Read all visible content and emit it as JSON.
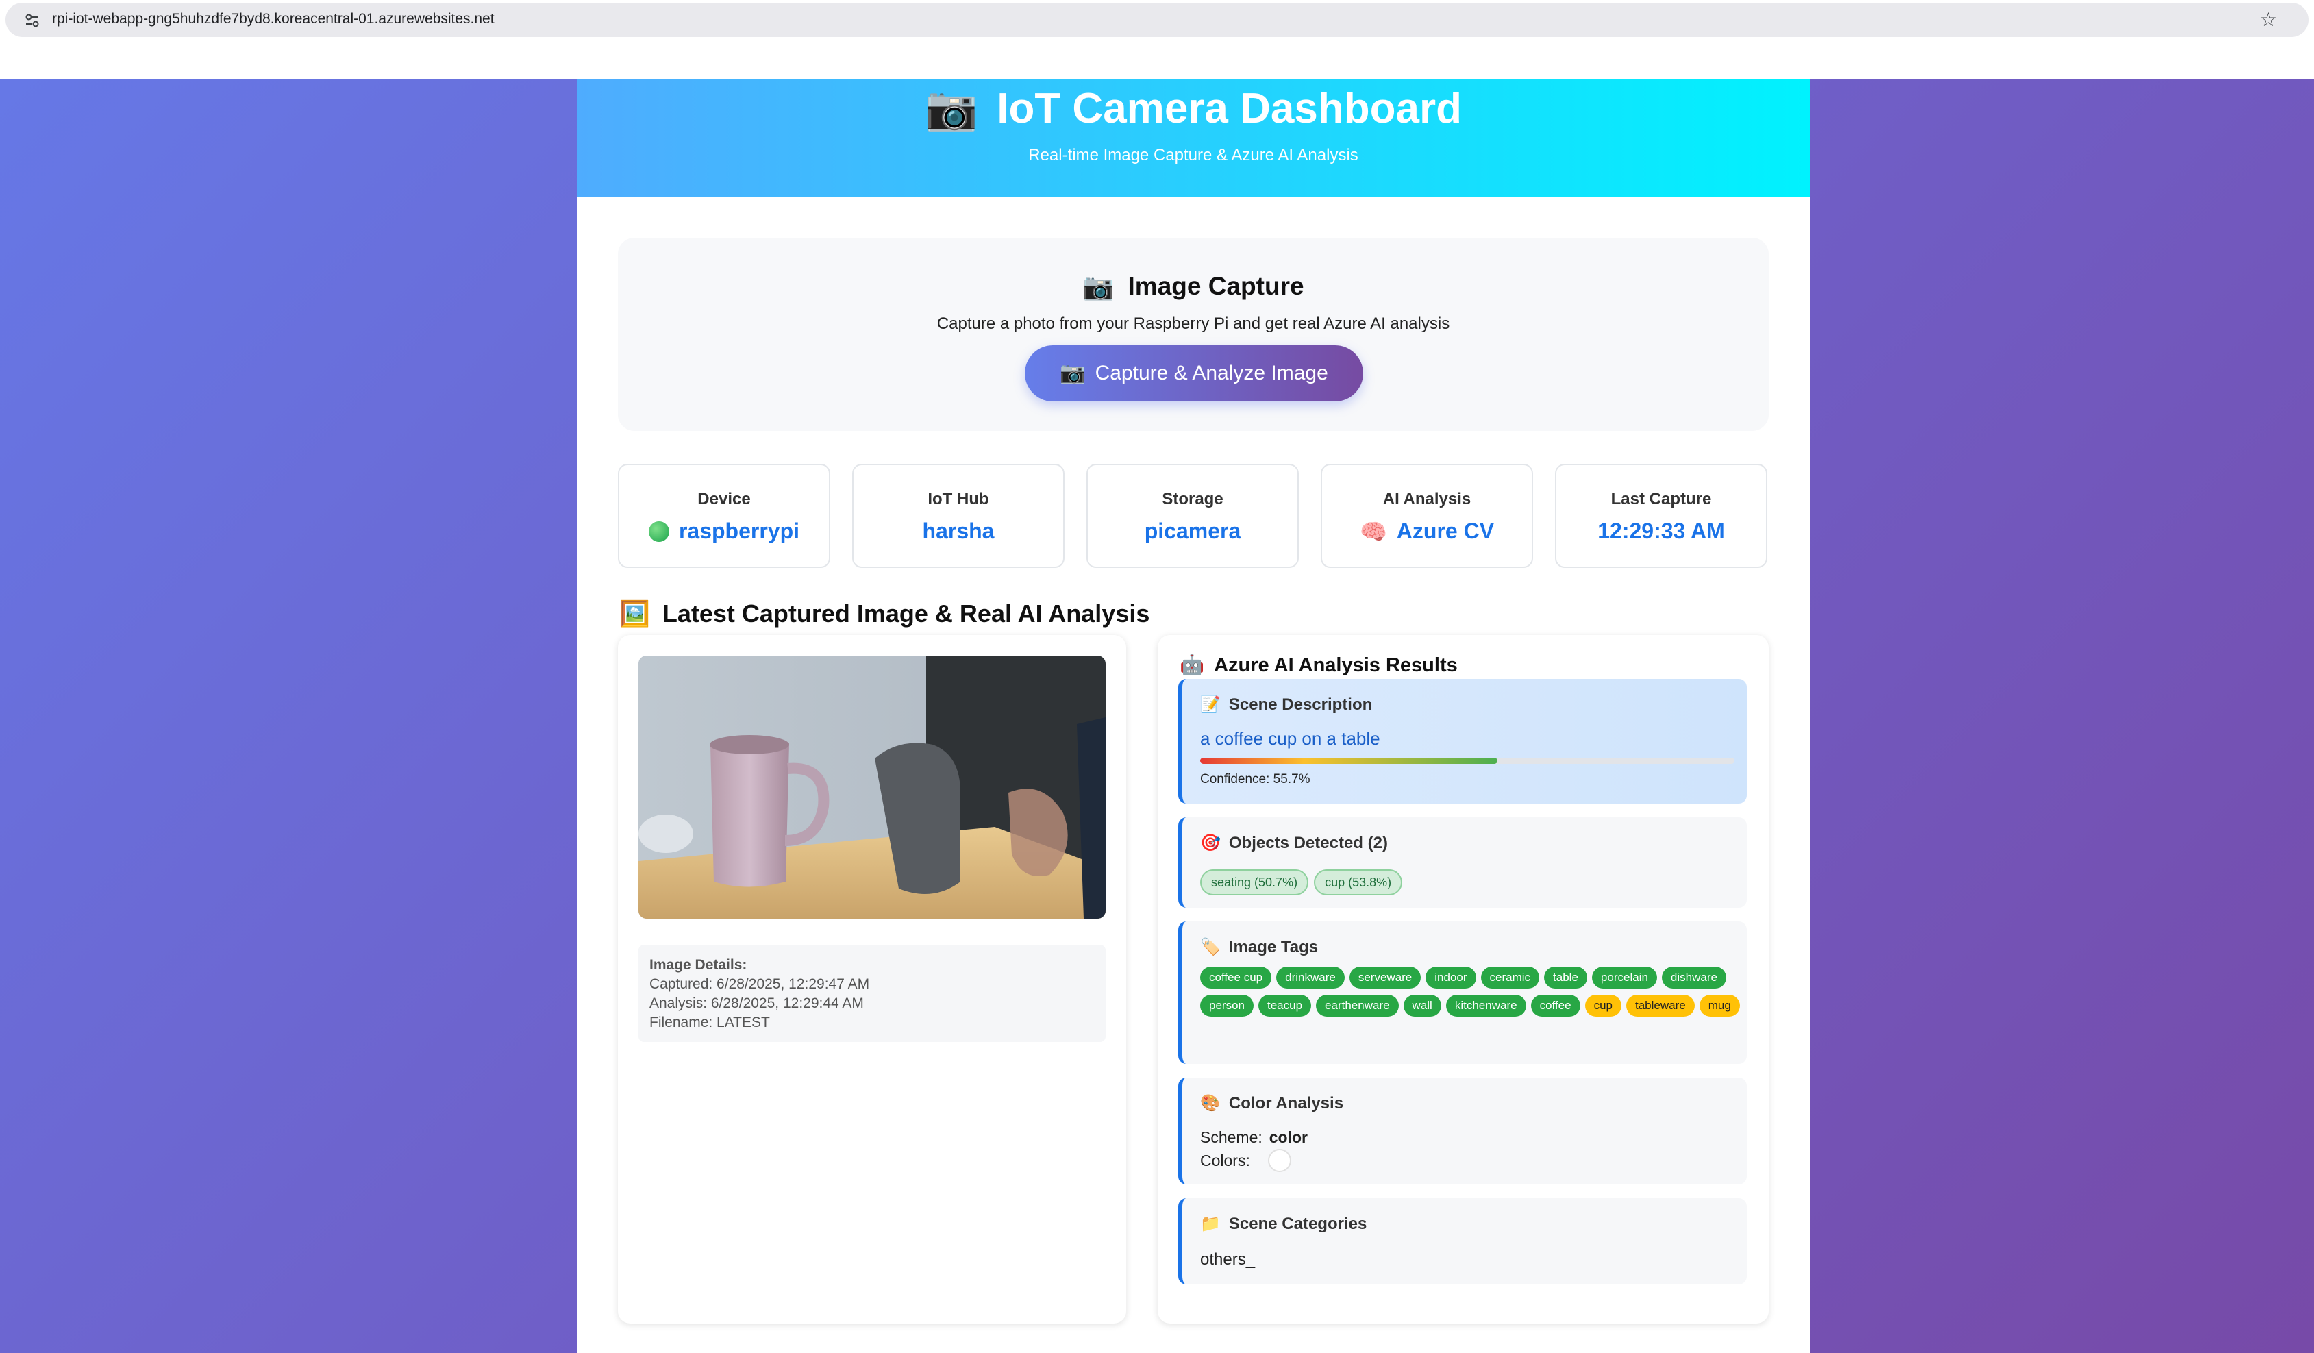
{
  "browser": {
    "url": "rpi-iot-webapp-gng5huhzdfe7byd8.koreacentral-01.azurewebsites.net",
    "site_icon": "site-info-icon",
    "bookmark_icon": "star-icon"
  },
  "header": {
    "icon": "📷",
    "title": "IoT Camera Dashboard",
    "subtitle": "Real-time Image Capture & Azure AI Analysis"
  },
  "capture": {
    "icon": "📷",
    "title": "Image Capture",
    "description": "Capture a photo from your Raspberry Pi and get real Azure AI analysis",
    "button_icon": "📷",
    "button_label": "Capture & Analyze Image"
  },
  "stats": [
    {
      "label": "Device",
      "value": "raspberrypi",
      "icon": "green-status-dot"
    },
    {
      "label": "IoT Hub",
      "value": "harsha"
    },
    {
      "label": "Storage",
      "value": "picamera"
    },
    {
      "label": "AI Analysis",
      "value": "Azure CV",
      "icon": "🧠"
    },
    {
      "label": "Last Capture",
      "value": "12:29:33 AM"
    }
  ],
  "section": {
    "icon": "🖼️",
    "title": "Latest Captured Image & Real AI Analysis"
  },
  "image_details": {
    "heading": "Image Details:",
    "captured": "Captured: 6/28/2025, 12:29:47 AM",
    "analysis": "Analysis: 6/28/2025, 12:29:44 AM",
    "filename": "Filename: LATEST"
  },
  "results": {
    "icon": "🤖",
    "title": "Azure AI Analysis Results",
    "scene": {
      "icon": "📝",
      "title": "Scene Description",
      "description": "a coffee cup on a table",
      "confidence": 0.557,
      "confidence_label": "Confidence: 55.7%"
    },
    "objects": {
      "icon": "🎯",
      "title": "Objects Detected (2)",
      "items": [
        "seating (50.7%)",
        "cup (53.8%)"
      ]
    },
    "tags": {
      "icon": "🏷️",
      "title": "Image Tags",
      "green": [
        "coffee cup",
        "drinkware",
        "serveware",
        "indoor",
        "ceramic",
        "table",
        "porcelain",
        "dishware",
        "person",
        "teacup",
        "earthenware",
        "wall",
        "kitchenware",
        "coffee"
      ],
      "yellow": [
        "cup",
        "tableware",
        "mug"
      ]
    },
    "color": {
      "icon": "🎨",
      "title": "Color Analysis",
      "scheme_label": "Scheme:",
      "scheme_value": "color",
      "colors_label": "Colors:",
      "swatch_color": "#ffffff"
    },
    "categories": {
      "icon": "📁",
      "title": "Scene Categories",
      "value": "others_"
    }
  },
  "colors": {
    "accent": "#1a73e8",
    "tag_green": "#28a745",
    "tag_yellow": "#ffc107"
  }
}
